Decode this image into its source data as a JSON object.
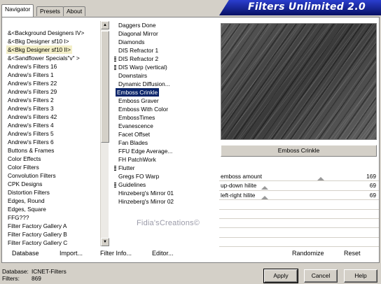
{
  "tabs": [
    "Navigator",
    "Presets",
    "About"
  ],
  "title": "Filters Unlimited 2.0",
  "categories": [
    "&<Background Designers IV>",
    "&<Bkg Designer sf10 I>",
    "&<Bkg Designer sf10 II>",
    "&<Sandflower Specials\"v\" >",
    "Andrew's Filters 16",
    "Andrew's Filters 1",
    "Andrew's Filters 22",
    "Andrew's Filters 29",
    "Andrew's Filters 2",
    "Andrew's Filters 3",
    "Andrew's Filters 42",
    "Andrew's Filters 4",
    "Andrew's Filters 5",
    "Andrew's Filters 6",
    "Buttons & Frames",
    "Color Effects",
    "Color Filters",
    "Convolution Filters",
    "CPK Designs",
    "Distortion Filters",
    "Edges, Round",
    "Edges, Square",
    "FFG???",
    "Filter Factory Gallery A",
    "Filter Factory Gallery B",
    "Filter Factory Gallery C"
  ],
  "selected_category_index": 2,
  "filters": [
    {
      "name": "Daggers Done",
      "mark": false
    },
    {
      "name": "Diagonal Mirror",
      "mark": false
    },
    {
      "name": "Diamonds",
      "mark": false
    },
    {
      "name": "DIS Refractor 1",
      "mark": false
    },
    {
      "name": "DIS Refractor 2",
      "mark": true
    },
    {
      "name": "DIS Warp (vertical)",
      "mark": true
    },
    {
      "name": "Downstairs",
      "mark": false
    },
    {
      "name": "Dynamic Diffusion...",
      "mark": false
    },
    {
      "name": "Emboss Crinkle",
      "mark": false
    },
    {
      "name": "Emboss Graver",
      "mark": false
    },
    {
      "name": "Emboss With Color",
      "mark": false
    },
    {
      "name": "EmbossTimes",
      "mark": false
    },
    {
      "name": "Evanescence",
      "mark": false
    },
    {
      "name": "Facet Offset",
      "mark": false
    },
    {
      "name": "Fan Blades",
      "mark": false
    },
    {
      "name": "FFU Edge Average...",
      "mark": false
    },
    {
      "name": "FH PatchWork",
      "mark": false
    },
    {
      "name": "Flutter",
      "mark": true
    },
    {
      "name": "Gregs FO Warp",
      "mark": false
    },
    {
      "name": "Guidelines",
      "mark": true
    },
    {
      "name": "Hinzeberg's Mirror 01",
      "mark": false
    },
    {
      "name": "Hinzeberg's Mirror 02",
      "mark": false
    }
  ],
  "selected_filter_index": 8,
  "selected_filter_name": "Emboss Crinkle",
  "params": [
    {
      "label": "emboss amount",
      "value": "169",
      "level": 0.66
    },
    {
      "label": "up-down hilite",
      "value": "69",
      "level": 0.27
    },
    {
      "label": "left-right hilite",
      "value": "69",
      "level": 0.27
    }
  ],
  "empty_param_rows": 5,
  "watermark": "Fidia'sCreations©",
  "panel_buttons": {
    "database": "Database",
    "import": "Import...",
    "filter_info": "Filter Info...",
    "editor": "Editor...",
    "randomize": "Randomize",
    "reset": "Reset"
  },
  "status": {
    "database_label": "Database:",
    "database_value": "ICNET-Filters",
    "filters_label": "Filters:",
    "filters_value": "869"
  },
  "dialog_buttons": {
    "apply": "Apply",
    "cancel": "Cancel",
    "help": "Help"
  },
  "colors": {
    "selection": "#0a246a",
    "banner": "#0a1b8c",
    "highlight": "#f3efc8"
  }
}
